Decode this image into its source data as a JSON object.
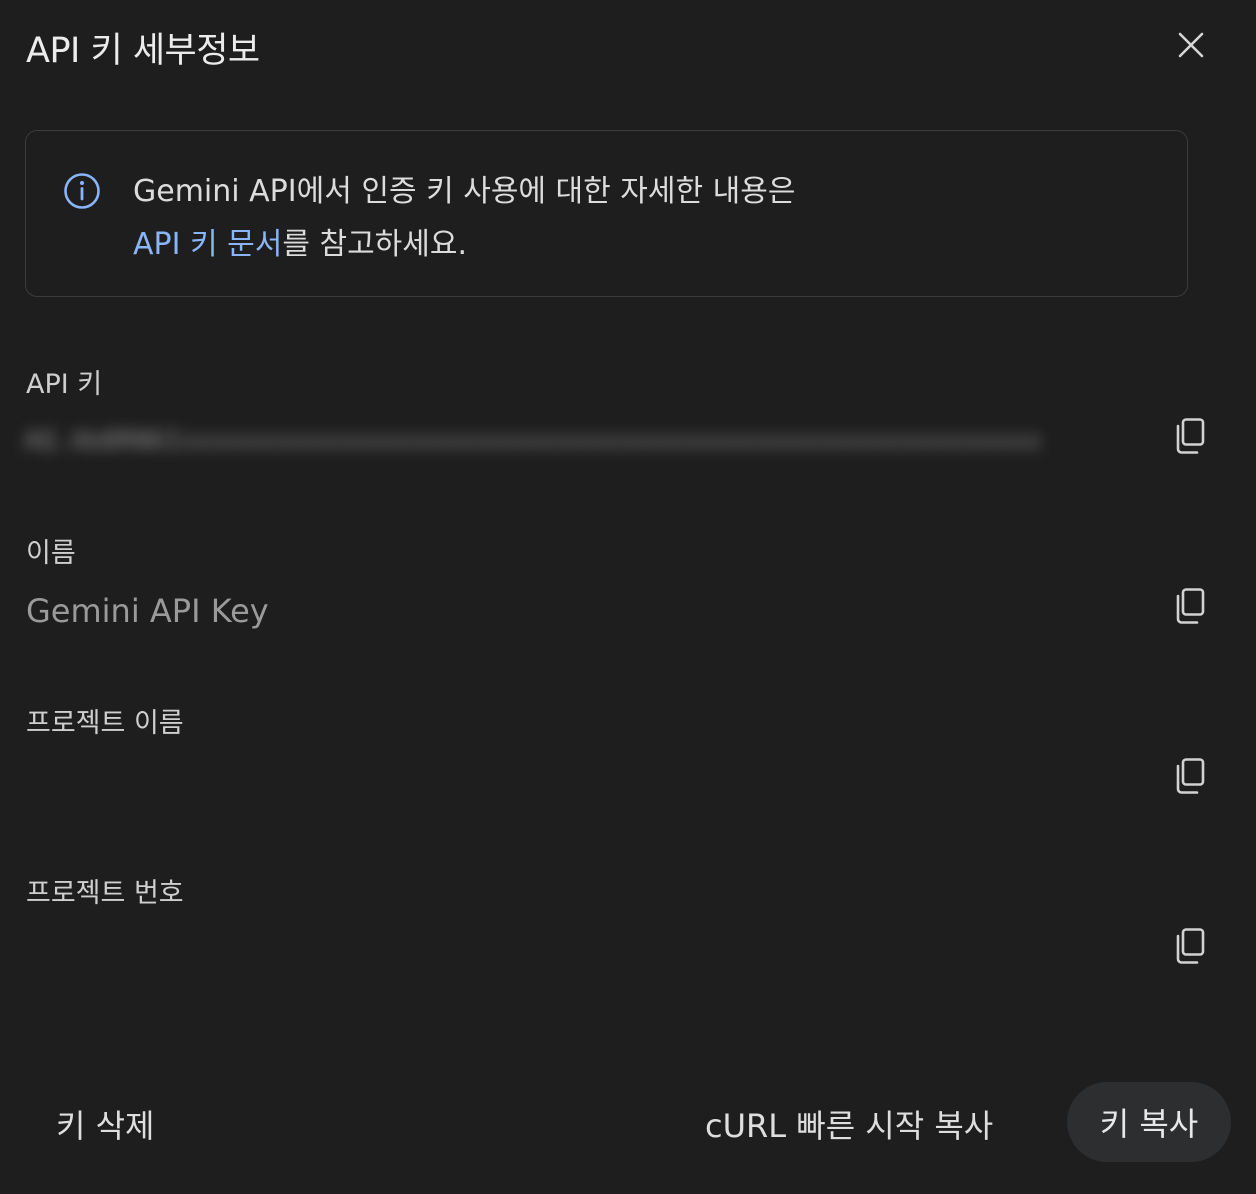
{
  "dialog": {
    "title": "API 키 세부정보",
    "close_icon": "close-icon"
  },
  "info": {
    "icon": "info-icon",
    "text_line1": "Gemini API에서 인증 키 사용에 대한 자세한 내용은",
    "link_text": "API 키 문서",
    "text_line2_suffix": "를 참고하세요.",
    "link_color": "#8ab4f8"
  },
  "fields": {
    "api_key": {
      "label": "API 키",
      "value": "AQ.Ab8RN6Ixxxxxxxxxxxxxxxxxxxxxxxxxxxxxxxxxxxxxxxxxxxxxxxxxxxxxxx",
      "value_blurred": true
    },
    "name": {
      "label": "이름",
      "value": "Gemini API Key"
    },
    "project_name": {
      "label": "프로젝트 이름",
      "value": ""
    },
    "project_number": {
      "label": "프로젝트 번호",
      "value": ""
    },
    "copy_icon": "copy-icon"
  },
  "footer": {
    "delete_label": "키 삭제",
    "curl_label": "cURL 빠른 시작 복사",
    "copy_key_label": "키 복사"
  },
  "colors": {
    "background": "#1e1e1f",
    "accent": "#8ab4f8",
    "button_bg": "#2d2e30"
  }
}
